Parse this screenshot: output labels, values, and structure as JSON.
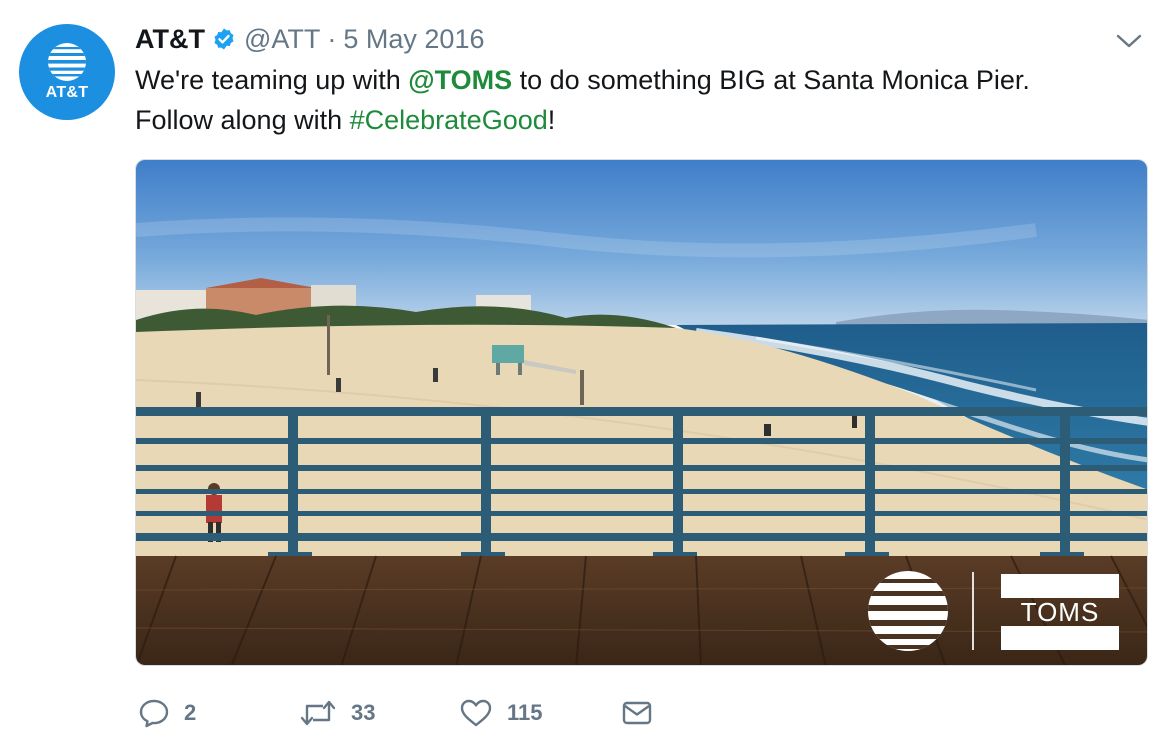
{
  "tweet": {
    "author_name": "AT&T",
    "handle": "@ATT",
    "separator": "·",
    "date": "5 May 2016",
    "text_part1": "We're teaming up with ",
    "mention": "@TOMS",
    "text_part2": " to do something BIG at Santa Monica Pier.",
    "text_part3": "Follow along with ",
    "hashtag": "#CelebrateGood",
    "text_part4": "!"
  },
  "avatar": {
    "label": "AT&T",
    "bg_color": "#1d8fe0"
  },
  "media": {
    "toms_logo_text": "TOMS"
  },
  "actions": {
    "reply_count": "2",
    "retweet_count": "33",
    "like_count": "115"
  },
  "colors": {
    "link": "#1e8a3b",
    "muted": "#657786",
    "verified": "#1da1f2"
  },
  "icons": [
    "globe-icon",
    "verified-badge-icon",
    "chevron-down-icon",
    "reply-icon",
    "retweet-icon",
    "like-icon",
    "message-icon"
  ]
}
